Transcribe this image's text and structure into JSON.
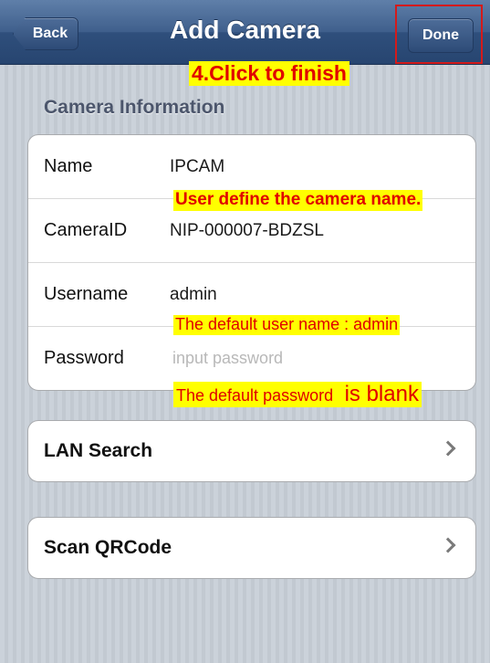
{
  "navbar": {
    "title": "Add Camera",
    "back_label": "Back",
    "done_label": "Done"
  },
  "annotations": {
    "finish": "4.Click to finish",
    "name_note": "User define the camera name.",
    "user_note": "The default user name : admin",
    "pass_note_main": "The default password",
    "pass_note_tail": "is blank"
  },
  "camera_info": {
    "header": "Camera Information",
    "rows": [
      {
        "label": "Name",
        "value": "IPCAM"
      },
      {
        "label": "CameraID",
        "value": "NIP-000007-BDZSL"
      },
      {
        "label": "Username",
        "value": "admin"
      },
      {
        "label": "Password",
        "value": "",
        "placeholder": "input password"
      }
    ]
  },
  "actions": [
    {
      "label": "LAN Search",
      "icon": "chevron-right-icon"
    },
    {
      "label": "Scan QRCode",
      "icon": "chevron-right-icon"
    }
  ],
  "colors": {
    "annotation_bg": "#ffff00",
    "annotation_text": "#e00000",
    "highlight_border": "#d41a1a",
    "navbar": "#3f5f8c"
  }
}
